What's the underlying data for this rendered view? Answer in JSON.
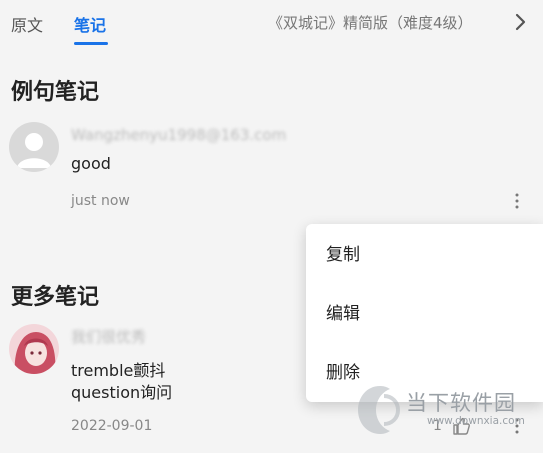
{
  "tabs": [
    {
      "label": "原文",
      "active": false
    },
    {
      "label": "笔记",
      "active": true
    }
  ],
  "book_title": "《双城记》精简版（难度4级）",
  "example_notes": {
    "title": "例句笔记",
    "note": {
      "username": "Wangzhenyu1998@163.com",
      "text": "good",
      "time": "just now"
    }
  },
  "more_notes": {
    "title": "更多笔记",
    "note": {
      "username": "我们很优秀",
      "text_lines": [
        "tremble颤抖",
        "question询问"
      ],
      "date": "2022-09-01",
      "like_count": "1"
    }
  },
  "context_menu": {
    "items": [
      "复制",
      "编辑",
      "删除"
    ]
  },
  "watermark": {
    "text": "当下软件园",
    "url": "www.downxia.com"
  },
  "colors": {
    "accent": "#1a73e8",
    "background": "#f4f4f4",
    "menu_background": "#ffffff"
  }
}
